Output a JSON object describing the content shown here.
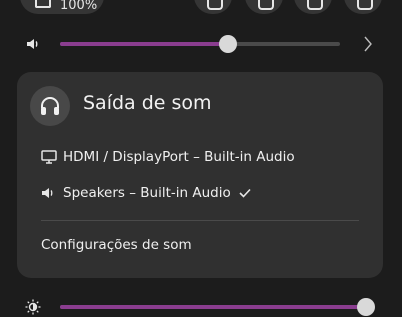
{
  "top_bar": {
    "battery_label": "100%"
  },
  "volume": {
    "level": 0.6,
    "fill_color": "#8a3d8f",
    "icon": "speaker-icon",
    "expand_icon": "chevron-right-icon"
  },
  "sound_output": {
    "title": "Saída de som",
    "icon": "headphones-icon",
    "devices": [
      {
        "label": "HDMI / DisplayPort – Built-in Audio",
        "icon": "monitor-icon",
        "selected": false
      },
      {
        "label": "Speakers – Built-in Audio",
        "icon": "speaker-icon",
        "selected": true
      }
    ],
    "settings_label": "Configurações de som"
  },
  "brightness": {
    "level": 1.0,
    "fill_color": "#8a3d8f",
    "icon": "brightness-icon"
  }
}
